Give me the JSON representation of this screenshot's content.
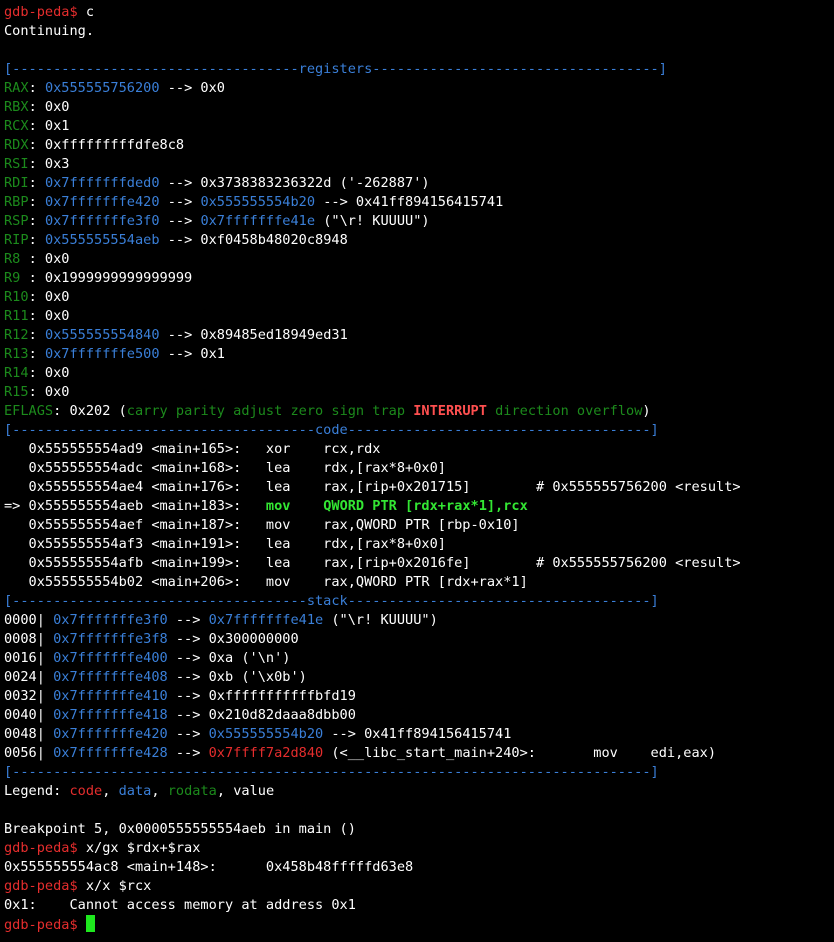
{
  "colors": {
    "background": "#000000",
    "text": "#ffffff",
    "prompt_red": "#e52d2d",
    "register_name_green": "#1c8a1c",
    "address_blue": "#3a7fd8",
    "current_instr_green": "#33e633",
    "interrupt_red": "#ff5050",
    "cursor": "#1ee81e"
  },
  "prompt": "gdb-peda$ ",
  "lines": [
    [
      {
        "c": "red",
        "t": "gdb-peda$ "
      },
      {
        "t": "c"
      }
    ],
    [
      {
        "t": "Continuing."
      }
    ],
    [],
    [
      {
        "c": "blu",
        "t": "[-----------------------------------registers-----------------------------------]"
      }
    ],
    [
      {
        "c": "grn",
        "t": "RAX"
      },
      {
        "t": ": "
      },
      {
        "c": "blu",
        "t": "0x555555756200"
      },
      {
        "t": " --> 0x0"
      }
    ],
    [
      {
        "c": "grn",
        "t": "RBX"
      },
      {
        "t": ": 0x0"
      }
    ],
    [
      {
        "c": "grn",
        "t": "RCX"
      },
      {
        "t": ": 0x1"
      }
    ],
    [
      {
        "c": "grn",
        "t": "RDX"
      },
      {
        "t": ": 0xfffffffffdfe8c8"
      }
    ],
    [
      {
        "c": "grn",
        "t": "RSI"
      },
      {
        "t": ": 0x3"
      }
    ],
    [
      {
        "c": "grn",
        "t": "RDI"
      },
      {
        "t": ": "
      },
      {
        "c": "blu",
        "t": "0x7fffffffded0"
      },
      {
        "t": " --> 0x3738383236322d ('-262887')"
      }
    ],
    [
      {
        "c": "grn",
        "t": "RBP"
      },
      {
        "t": ": "
      },
      {
        "c": "blu",
        "t": "0x7fffffffe420"
      },
      {
        "t": " --> "
      },
      {
        "c": "blu",
        "t": "0x555555554b20"
      },
      {
        "t": " --> 0x41ff894156415741"
      }
    ],
    [
      {
        "c": "grn",
        "t": "RSP"
      },
      {
        "t": ": "
      },
      {
        "c": "blu",
        "t": "0x7fffffffe3f0"
      },
      {
        "t": " --> "
      },
      {
        "c": "blu",
        "t": "0x7fffffffe41e"
      },
      {
        "t": " (\"\\r! KUUUU\")"
      }
    ],
    [
      {
        "c": "grn",
        "t": "RIP"
      },
      {
        "t": ": "
      },
      {
        "c": "blu",
        "t": "0x555555554aeb"
      },
      {
        "t": " --> 0xf0458b48020c8948"
      }
    ],
    [
      {
        "c": "grn",
        "t": "R8 "
      },
      {
        "t": ": 0x0"
      }
    ],
    [
      {
        "c": "grn",
        "t": "R9 "
      },
      {
        "t": ": 0x1999999999999999"
      }
    ],
    [
      {
        "c": "grn",
        "t": "R10"
      },
      {
        "t": ": 0x0"
      }
    ],
    [
      {
        "c": "grn",
        "t": "R11"
      },
      {
        "t": ": 0x0"
      }
    ],
    [
      {
        "c": "grn",
        "t": "R12"
      },
      {
        "t": ": "
      },
      {
        "c": "blu",
        "t": "0x555555554840"
      },
      {
        "t": " --> 0x89485ed18949ed31"
      }
    ],
    [
      {
        "c": "grn",
        "t": "R13"
      },
      {
        "t": ": "
      },
      {
        "c": "blu",
        "t": "0x7fffffffe500"
      },
      {
        "t": " --> 0x1"
      }
    ],
    [
      {
        "c": "grn",
        "t": "R14"
      },
      {
        "t": ": 0x0"
      }
    ],
    [
      {
        "c": "grn",
        "t": "R15"
      },
      {
        "t": ": 0x0"
      }
    ],
    [
      {
        "c": "grn",
        "t": "EFLAGS"
      },
      {
        "t": ": 0x202 ("
      },
      {
        "c": "grn",
        "t": "carry parity adjust zero sign trap "
      },
      {
        "c": "bred",
        "t": "INTERRUPT"
      },
      {
        "c": "grn",
        "t": " direction overflow"
      },
      {
        "t": ")"
      }
    ],
    [
      {
        "c": "blu",
        "t": "[-------------------------------------code-------------------------------------]"
      }
    ],
    [
      {
        "t": "   0x555555554ad9 <main+165>:   xor    rcx,rdx"
      }
    ],
    [
      {
        "t": "   0x555555554adc <main+168>:   lea    rdx,[rax*8+0x0]"
      }
    ],
    [
      {
        "t": "   0x555555554ae4 <main+176>:   lea    rax,[rip+0x201715]        # 0x555555756200 <result>"
      }
    ],
    [
      {
        "t": "=> 0x555555554aeb <main+183>:   "
      },
      {
        "c": "bgrn",
        "t": "mov    QWORD PTR [rdx+rax*1],rcx"
      }
    ],
    [
      {
        "t": "   0x555555554aef <main+187>:   mov    rax,QWORD PTR [rbp-0x10]"
      }
    ],
    [
      {
        "t": "   0x555555554af3 <main+191>:   lea    rdx,[rax*8+0x0]"
      }
    ],
    [
      {
        "t": "   0x555555554afb <main+199>:   lea    rax,[rip+0x2016fe]        # 0x555555756200 <result>"
      }
    ],
    [
      {
        "t": "   0x555555554b02 <main+206>:   mov    rax,QWORD PTR [rdx+rax*1]"
      }
    ],
    [
      {
        "c": "blu",
        "t": "[------------------------------------stack-------------------------------------]"
      }
    ],
    [
      {
        "t": "0000| "
      },
      {
        "c": "blu",
        "t": "0x7fffffffe3f0"
      },
      {
        "t": " --> "
      },
      {
        "c": "blu",
        "t": "0x7fffffffe41e"
      },
      {
        "t": " (\"\\r! KUUUU\")"
      }
    ],
    [
      {
        "t": "0008| "
      },
      {
        "c": "blu",
        "t": "0x7fffffffe3f8"
      },
      {
        "t": " --> 0x300000000"
      }
    ],
    [
      {
        "t": "0016| "
      },
      {
        "c": "blu",
        "t": "0x7fffffffe400"
      },
      {
        "t": " --> 0xa ('\\n')"
      }
    ],
    [
      {
        "t": "0024| "
      },
      {
        "c": "blu",
        "t": "0x7fffffffe408"
      },
      {
        "t": " --> 0xb ('\\x0b')"
      }
    ],
    [
      {
        "t": "0032| "
      },
      {
        "c": "blu",
        "t": "0x7fffffffe410"
      },
      {
        "t": " --> 0xfffffffffffbfd19"
      }
    ],
    [
      {
        "t": "0040| "
      },
      {
        "c": "blu",
        "t": "0x7fffffffe418"
      },
      {
        "t": " --> 0x210d82daaa8dbb00"
      }
    ],
    [
      {
        "t": "0048| "
      },
      {
        "c": "blu",
        "t": "0x7fffffffe420"
      },
      {
        "t": " --> "
      },
      {
        "c": "blu",
        "t": "0x555555554b20"
      },
      {
        "t": " --> 0x41ff894156415741"
      }
    ],
    [
      {
        "t": "0056| "
      },
      {
        "c": "blu",
        "t": "0x7fffffffe428"
      },
      {
        "t": " --> "
      },
      {
        "c": "red",
        "t": "0x7ffff7a2d840"
      },
      {
        "t": " (<__libc_start_main+240>:       mov    edi,eax)"
      }
    ],
    [
      {
        "c": "blu",
        "t": "[------------------------------------------------------------------------------]"
      }
    ],
    [
      {
        "t": "Legend: "
      },
      {
        "c": "red",
        "t": "code"
      },
      {
        "t": ", "
      },
      {
        "c": "blu",
        "t": "data"
      },
      {
        "t": ", "
      },
      {
        "c": "grn",
        "t": "rodata"
      },
      {
        "t": ", value"
      }
    ],
    [],
    [
      {
        "t": "Breakpoint 5, 0x0000555555554aeb in main ()"
      }
    ],
    [
      {
        "c": "red",
        "t": "gdb-peda$ "
      },
      {
        "t": "x/gx $rdx+$rax"
      }
    ],
    [
      {
        "t": "0x555555554ac8 <main+148>:      0x458b48fffffd63e8"
      }
    ],
    [
      {
        "c": "red",
        "t": "gdb-peda$ "
      },
      {
        "t": "x/x $rcx"
      }
    ],
    [
      {
        "t": "0x1:    Cannot access memory at address 0x1"
      }
    ]
  ]
}
